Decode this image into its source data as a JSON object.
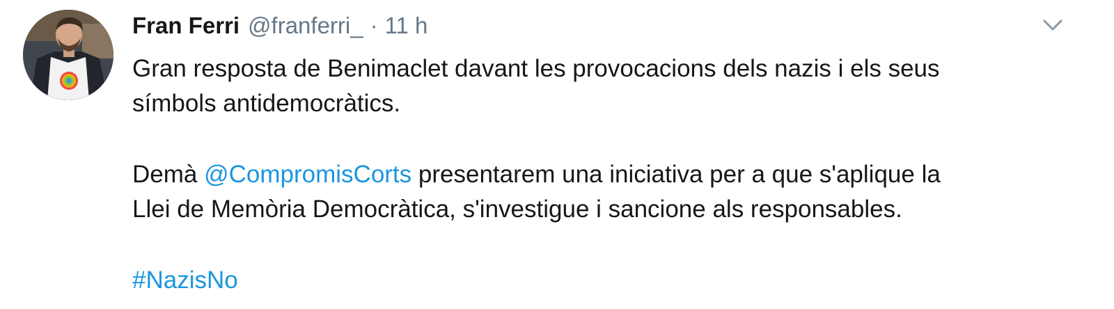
{
  "tweet": {
    "author": {
      "display_name": "Fran Ferri",
      "handle": "@franferri_",
      "separator": "·",
      "time": "11 h"
    },
    "text": {
      "line1": "Gran resposta de Benimaclet davant les provocacions dels nazis i els seus",
      "line2": "símbols antidemocràtics.",
      "para2_prefix": "Demà ",
      "mention": "@CompromisCorts",
      "para2_suffix": " presentarem una iniciativa per a que s'aplique la",
      "line4": "Llei de Memòria Democràtica, s'investigue i sancione als responsables.",
      "hashtag": "#NazisNo"
    },
    "icons": {
      "menu": "chevron-down-icon",
      "avatar": "profile-photo"
    },
    "colors": {
      "link": "#1b95e0",
      "text": "#14171a",
      "muted": "#657786"
    }
  }
}
